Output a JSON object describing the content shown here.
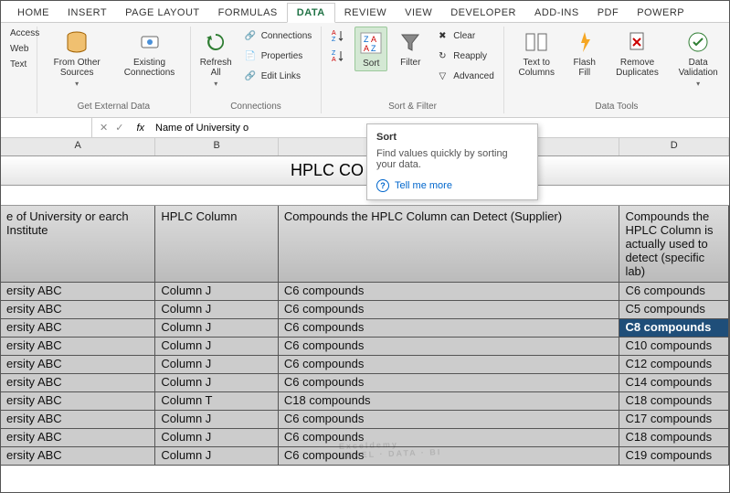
{
  "tabs": [
    "HOME",
    "INSERT",
    "PAGE LAYOUT",
    "FORMULAS",
    "DATA",
    "REVIEW",
    "VIEW",
    "DEVELOPER",
    "ADD-INS",
    "PDF",
    "POWERP"
  ],
  "active_tab": "DATA",
  "ribbon": {
    "ext": {
      "access": "Access",
      "web": "Web",
      "text": "Text",
      "from_other": "From Other Sources",
      "existing": "Existing Connections",
      "label": "Get External Data"
    },
    "conn": {
      "refresh": "Refresh All",
      "connections": "Connections",
      "properties": "Properties",
      "editlinks": "Edit Links",
      "label": "Connections"
    },
    "sortfilter": {
      "sort_az": "A→Z",
      "sort": "Sort",
      "filter": "Filter",
      "clear": "Clear",
      "reapply": "Reapply",
      "advanced": "Advanced",
      "label": "Sort & Filter"
    },
    "datatools": {
      "text_to_columns": "Text to Columns",
      "flash_fill": "Flash Fill",
      "remove_dup": "Remove Duplicates",
      "validation": "Data Validation",
      "label": "Data Tools"
    }
  },
  "formula_bar": {
    "namebox": "",
    "text": "Name of University o"
  },
  "col_headers": [
    "A",
    "B",
    "C",
    "D"
  ],
  "title_row": "HPLC CO                           HE AREA",
  "table_headers": {
    "a": "e of University or earch Institute",
    "b": "HPLC Column",
    "c": "Compounds the HPLC Column can Detect (Supplier)",
    "d": "Compounds the HPLC Column is actually used to detect (specific lab)"
  },
  "rows": [
    {
      "a": "ersity ABC",
      "b": "Column J",
      "c": "C6 compounds",
      "d": "C6 compounds"
    },
    {
      "a": "ersity ABC",
      "b": "Column J",
      "c": "C6 compounds",
      "d": "C5 compounds"
    },
    {
      "a": "ersity ABC",
      "b": "Column J",
      "c": "C6 compounds",
      "d": "C8 compounds"
    },
    {
      "a": "ersity ABC",
      "b": "Column J",
      "c": "C6 compounds",
      "d": "C10 compounds"
    },
    {
      "a": "ersity ABC",
      "b": "Column J",
      "c": "C6 compounds",
      "d": "C12 compounds"
    },
    {
      "a": "ersity ABC",
      "b": "Column J",
      "c": "C6 compounds",
      "d": "C14 compounds"
    },
    {
      "a": "ersity ABC",
      "b": "Column T",
      "c": "C18 compounds",
      "d": "C18 compounds"
    },
    {
      "a": "ersity ABC",
      "b": "Column J",
      "c": "C6 compounds",
      "d": "C17 compounds"
    },
    {
      "a": "ersity ABC",
      "b": "Column J",
      "c": "C6 compounds",
      "d": "C18 compounds"
    },
    {
      "a": "ersity ABC",
      "b": "Column J",
      "c": "C6 compounds",
      "d": "C19 compounds"
    }
  ],
  "selected_row_index": 2,
  "tooltip": {
    "title": "Sort",
    "body": "Find values quickly by sorting your data.",
    "more": "Tell me more"
  },
  "watermark": {
    "main": "Exceldemy",
    "sub": "EXCEL · DATA · BI"
  }
}
